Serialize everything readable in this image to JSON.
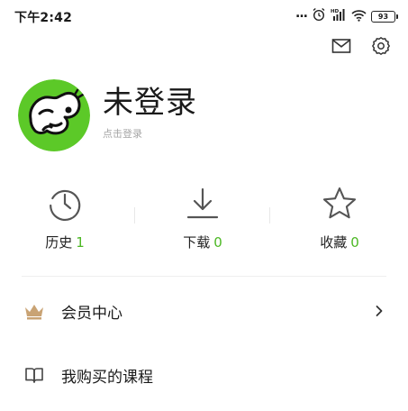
{
  "status_bar": {
    "time": "下午2:42",
    "dots": "...",
    "battery": "93",
    "icons": [
      "alarm-icon",
      "hd-signal-icon",
      "wifi-icon",
      "battery-icon"
    ]
  },
  "header": {
    "actions": [
      "mail-icon",
      "settings-icon"
    ]
  },
  "profile": {
    "name": "未登录",
    "subtitle": "点击登录",
    "avatar_colors": {
      "ring": "#5cc928",
      "accent": "#ffffff"
    }
  },
  "stats": [
    {
      "icon": "clock-icon",
      "label": "历史",
      "count": "1"
    },
    {
      "icon": "download-icon",
      "label": "下载",
      "count": "0"
    },
    {
      "icon": "star-icon",
      "label": "收藏",
      "count": "0"
    }
  ],
  "menu": [
    {
      "icon": "crown-icon",
      "label": "会员中心",
      "has_chevron": true
    },
    {
      "icon": "book-icon",
      "label": "我购买的课程",
      "has_chevron": false
    }
  ],
  "colors": {
    "accent_green": "#4cb824",
    "crown": "#c9a374",
    "icon_gray": "#555555"
  }
}
